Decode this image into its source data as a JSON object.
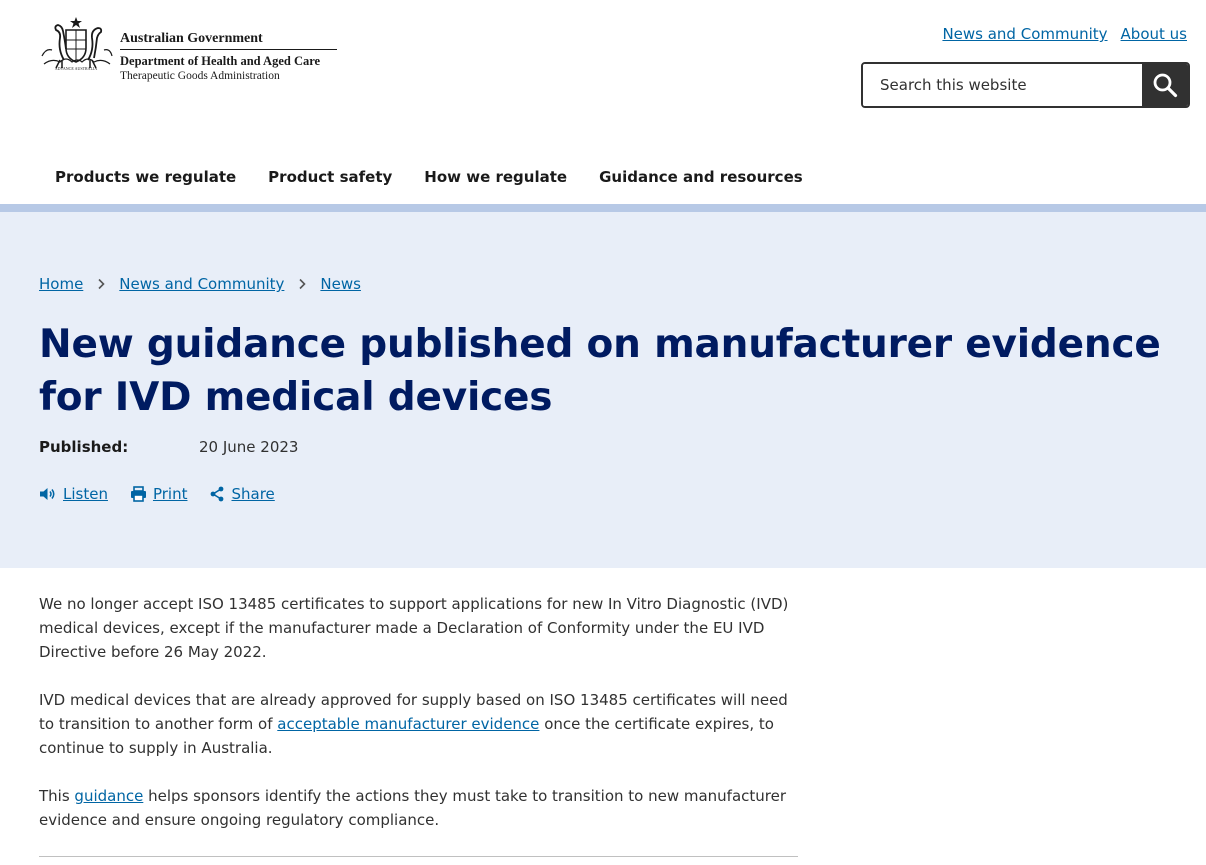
{
  "header": {
    "logo": {
      "gov": "Australian Government",
      "dept": "Department of Health and Aged Care",
      "agency": "Therapeutic Goods Administration"
    },
    "utility_links": [
      "News and Community",
      "About us"
    ],
    "search": {
      "placeholder": "Search this website",
      "button_icon": "search-icon"
    }
  },
  "nav": {
    "items": [
      "Products we regulate",
      "Product safety",
      "How we regulate",
      "Guidance and resources"
    ]
  },
  "breadcrumb": {
    "items": [
      "Home",
      "News and Community",
      "News"
    ]
  },
  "article": {
    "title": "New guidance published on manufacturer evidence for IVD medical devices",
    "published_label": "Published:",
    "published_date": "20 June 2023",
    "actions": {
      "listen": "Listen",
      "print": "Print",
      "share": "Share"
    },
    "p1": "We no longer accept ISO 13485 certificates to support applications for new In Vitro Diagnostic (IVD) medical devices, except if the manufacturer made a Declaration of Conformity under the EU IVD Directive before 26 May 2022.",
    "p2_before": "IVD medical devices that are already approved for supply based on ISO 13485 certificates will need to transition to another form of ",
    "p2_link": "acceptable manufacturer evidence",
    "p2_after": " once the certificate expires, to continue to supply in Australia.",
    "p3_before": "This ",
    "p3_link": "guidance",
    "p3_after": " helps sponsors identify the actions they must take to transition to new manufacturer evidence and ensure ongoing regulatory compliance."
  },
  "colors": {
    "link": "#0065a4",
    "title": "#001b61",
    "hero_bg": "#e8eef8",
    "nav_rule": "#b7c9e6",
    "search_button": "#313131"
  }
}
